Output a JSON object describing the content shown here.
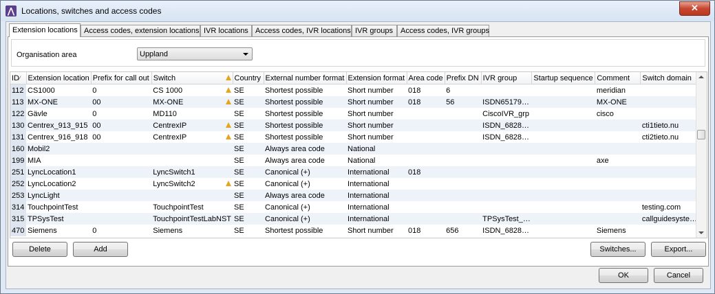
{
  "window": {
    "title": "Locations, switches and access codes",
    "close_label": "✕"
  },
  "tabs": [
    {
      "label": "Extension locations"
    },
    {
      "label": "Access codes, extension locations"
    },
    {
      "label": "IVR locations"
    },
    {
      "label": "Access codes, IVR locations"
    },
    {
      "label": "IVR groups"
    },
    {
      "label": "Access codes, IVR groups"
    }
  ],
  "org": {
    "label": "Organisation area",
    "value": "Uppland"
  },
  "table": {
    "headers": [
      "ID",
      "Extension location",
      "Prefix for call out",
      "Switch",
      "Country",
      "External number format",
      "Extension format",
      "Area code",
      "Prefix DN",
      "IVR group",
      "Startup sequence",
      "Comment",
      "Switch domain"
    ],
    "rows": [
      {
        "id": "112",
        "loc": "CS1000",
        "prefix": "0",
        "switch": "CS 1000",
        "warn": true,
        "country": "SE",
        "ext_fmt": "Shortest possible",
        "ext_format": "Short number",
        "area": "018",
        "prefix_dn": "6",
        "ivr": "",
        "startup": "",
        "comment": "meridian",
        "domain": ""
      },
      {
        "id": "113",
        "loc": "MX-ONE",
        "prefix": "00",
        "switch": "MX-ONE",
        "warn": true,
        "country": "SE",
        "ext_fmt": "Shortest possible",
        "ext_format": "Short number",
        "area": "018",
        "prefix_dn": "56",
        "ivr": "ISDN65179…",
        "startup": "",
        "comment": "MX-ONE",
        "domain": ""
      },
      {
        "id": "122",
        "loc": "Gävle",
        "prefix": "0",
        "switch": "MD110",
        "warn": false,
        "country": "SE",
        "ext_fmt": "Shortest possible",
        "ext_format": "Short number",
        "area": "",
        "prefix_dn": "",
        "ivr": "CiscoIVR_grp",
        "startup": "",
        "comment": "cisco",
        "domain": ""
      },
      {
        "id": "130",
        "loc": "Centrex_913_915",
        "prefix": "00",
        "switch": "CentrexIP",
        "warn": true,
        "country": "SE",
        "ext_fmt": "Shortest possible",
        "ext_format": "Short number",
        "area": "",
        "prefix_dn": "",
        "ivr": "ISDN_6828…",
        "startup": "",
        "comment": "",
        "domain": "cti1tieto.nu"
      },
      {
        "id": "131",
        "loc": "Centrex_916_918",
        "prefix": "00",
        "switch": "CentrexIP",
        "warn": true,
        "country": "SE",
        "ext_fmt": "Shortest possible",
        "ext_format": "Short number",
        "area": "",
        "prefix_dn": "",
        "ivr": "ISDN_6828…",
        "startup": "",
        "comment": "",
        "domain": "cti2tieto.nu"
      },
      {
        "id": "160",
        "loc": "Mobil2",
        "prefix": "",
        "switch": "",
        "warn": false,
        "country": "SE",
        "ext_fmt": "Always area code",
        "ext_format": "National",
        "area": "",
        "prefix_dn": "",
        "ivr": "",
        "startup": "",
        "comment": "",
        "domain": ""
      },
      {
        "id": "199",
        "loc": "MIA",
        "prefix": "",
        "switch": "",
        "warn": false,
        "country": "SE",
        "ext_fmt": "Always area code",
        "ext_format": "National",
        "area": "",
        "prefix_dn": "",
        "ivr": "",
        "startup": "",
        "comment": "axe",
        "domain": ""
      },
      {
        "id": "251",
        "loc": "LyncLocation1",
        "prefix": "",
        "switch": "LyncSwitch1",
        "warn": false,
        "country": "SE",
        "ext_fmt": "Canonical (+)",
        "ext_format": "International",
        "area": "018",
        "prefix_dn": "",
        "ivr": "",
        "startup": "",
        "comment": "",
        "domain": ""
      },
      {
        "id": "252",
        "loc": "LyncLocation2",
        "prefix": "",
        "switch": "LyncSwitch2",
        "warn": true,
        "country": "SE",
        "ext_fmt": "Canonical (+)",
        "ext_format": "International",
        "area": "",
        "prefix_dn": "",
        "ivr": "",
        "startup": "",
        "comment": "",
        "domain": ""
      },
      {
        "id": "253",
        "loc": "LyncLight",
        "prefix": "",
        "switch": "",
        "warn": false,
        "country": "SE",
        "ext_fmt": "Always area code",
        "ext_format": "International",
        "area": "",
        "prefix_dn": "",
        "ivr": "",
        "startup": "",
        "comment": "",
        "domain": ""
      },
      {
        "id": "314",
        "loc": "TouchpointTest",
        "prefix": "",
        "switch": "TouchpointTest",
        "warn": false,
        "country": "SE",
        "ext_fmt": "Canonical (+)",
        "ext_format": "International",
        "area": "",
        "prefix_dn": "",
        "ivr": "",
        "startup": "",
        "comment": "",
        "domain": "testing.com"
      },
      {
        "id": "315",
        "loc": "TPSysTest",
        "prefix": "",
        "switch": "TouchpointTestLabNST",
        "warn": false,
        "country": "SE",
        "ext_fmt": "Canonical (+)",
        "ext_format": "International",
        "area": "",
        "prefix_dn": "",
        "ivr": "TPSysTest_…",
        "startup": "",
        "comment": "",
        "domain": "callguidesyste…"
      },
      {
        "id": "470",
        "loc": "Siemens",
        "prefix": "0",
        "switch": "Siemens",
        "warn": false,
        "country": "SE",
        "ext_fmt": "Shortest possible",
        "ext_format": "Short number",
        "area": "018",
        "prefix_dn": "656",
        "ivr": "ISDN_6828…",
        "startup": "",
        "comment": "Siemens",
        "domain": ""
      }
    ]
  },
  "buttons": {
    "delete": "Delete",
    "add": "Add",
    "switches": "Switches...",
    "export": "Export...",
    "ok": "OK",
    "cancel": "Cancel"
  },
  "icons": {
    "app": "app-logo-icon",
    "warning": "warning-icon",
    "dropdown": "chevron-down-icon"
  }
}
